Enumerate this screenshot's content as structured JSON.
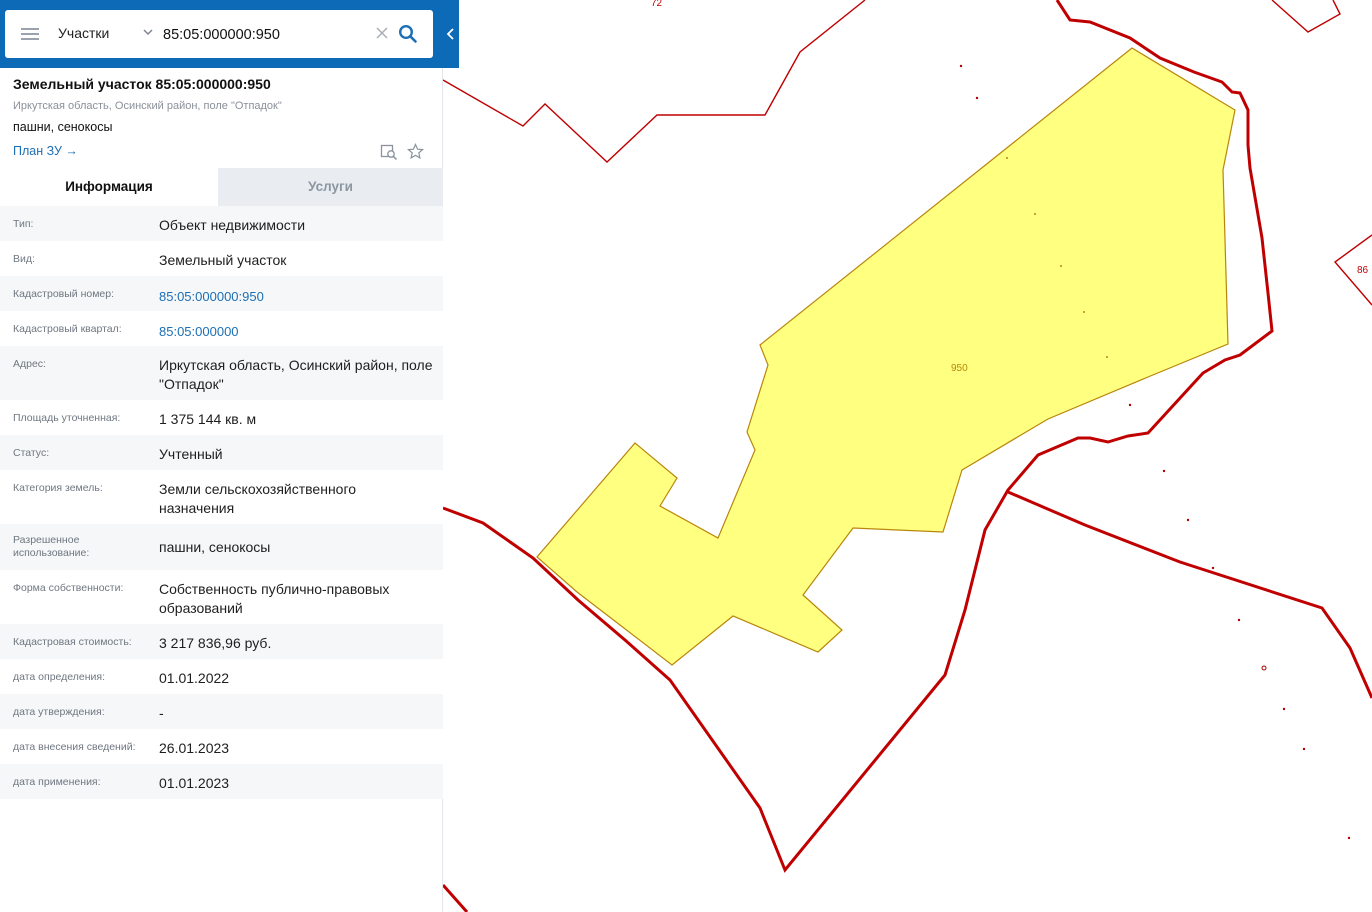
{
  "search": {
    "layer": "Участки",
    "query": "85:05:000000:950"
  },
  "object": {
    "title": "Земельный участок 85:05:000000:950",
    "address_short": "Иркутская область, Осинский район, поле \"Отпадок\"",
    "use": "пашни, сенокосы",
    "plan_link": "План ЗУ →"
  },
  "tabs": {
    "info": "Информация",
    "services": "Услуги"
  },
  "info_rows": [
    {
      "label": "Тип:",
      "value": "Объект недвижимости"
    },
    {
      "label": "Вид:",
      "value": "Земельный участок"
    },
    {
      "label": "Кадастровый номер:",
      "value": "85:05:000000:950",
      "link": true
    },
    {
      "label": "Кадастровый квартал:",
      "value": "85:05:000000",
      "link": true
    },
    {
      "label": "Адрес:",
      "value": "Иркутская область, Осинский район, поле \"Отпадок\""
    },
    {
      "label": "Площадь уточненная:",
      "value": "1 375 144 кв. м"
    },
    {
      "label": "Статус:",
      "value": "Учтенный"
    },
    {
      "label": "Категория земель:",
      "value": "Земли сельскохозяйственного назначения"
    },
    {
      "label": "Разрешенное использование:",
      "value": "пашни, сенокосы"
    },
    {
      "label": "Форма собственности:",
      "value": "Собственность публично-правовых образований"
    },
    {
      "label": "Кадастровая стоимость:",
      "value": "3 217 836,96 руб."
    },
    {
      "label": "дата определения:",
      "value": "01.01.2022"
    },
    {
      "label": "дата утверждения:",
      "value": "-"
    },
    {
      "label": "дата внесения сведений:",
      "value": "26.01.2023"
    },
    {
      "label": "дата применения:",
      "value": "01.01.2023"
    }
  ],
  "map": {
    "parcel_label": "950",
    "top_label": "72",
    "right_label": "86",
    "colors": {
      "parcel_fill": "#ffff80",
      "parcel_stroke": "#b8860b",
      "boundary": "#c00000",
      "accent": "#0d6ab6"
    }
  }
}
